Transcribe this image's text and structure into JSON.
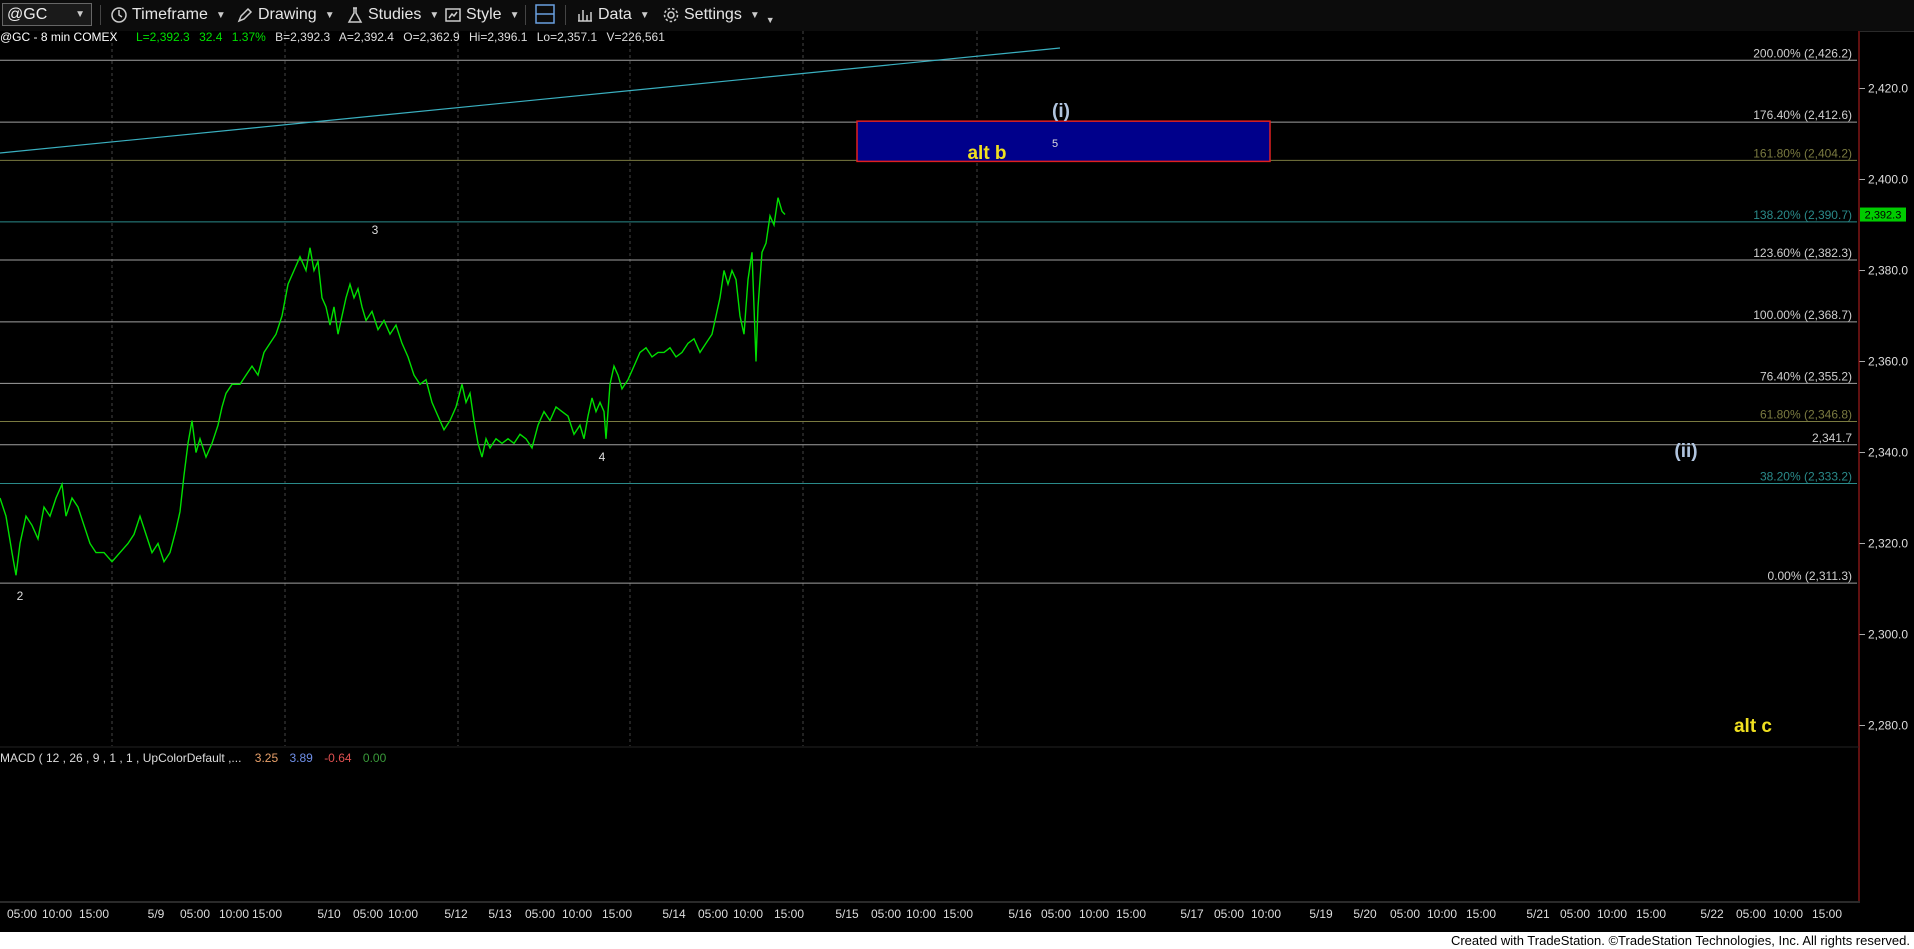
{
  "toolbar": {
    "symbol": "@GC",
    "timeframe": "Timeframe",
    "drawing": "Drawing",
    "studies": "Studies",
    "style": "Style",
    "data": "Data",
    "settings": "Settings"
  },
  "header": {
    "symbol_info": "@GC - 8 min  COMEX",
    "last": "L=2,392.3",
    "change": "32.4",
    "pct": "1.37%",
    "bid": "B=2,392.3",
    "ask": "A=2,392.4",
    "open": "O=2,362.9",
    "high": "Hi=2,396.1",
    "low": "Lo=2,357.1",
    "volume": "V=226,561"
  },
  "macd": {
    "label": "MACD ( 12 , 26 , 9 , 1 , 1 , UpColorDefault ,...",
    "v1": "3.25",
    "v1_color": "#e8a06a",
    "v2": "3.89",
    "v2_color": "#6f8fe8",
    "v3": "-0.64",
    "v3_color": "#e05050",
    "v4": "0.00",
    "v4_color": "#3a9a3a"
  },
  "footer": "Created with TradeStation. ©TradeStation Technologies, Inc. All rights reserved.",
  "annotations": {
    "wave_i": "(i)",
    "wave_ii": "(ii)",
    "alt_b": "alt b",
    "alt_c": "alt c",
    "w2": "2",
    "w3": "3",
    "w4": "4",
    "w5": "5"
  },
  "colors": {
    "price": "#00e000",
    "last_badge": "#00cc00",
    "target_box": "#00008b",
    "target_border": "#e02020"
  },
  "chart_data": {
    "type": "line",
    "title": "@GC - 8 min COMEX",
    "ylim": [
      2273,
      2431
    ],
    "y_ticks": [
      "2,420.0",
      "2,400.0",
      "2,380.0",
      "2,360.0",
      "2,340.0",
      "2,320.0",
      "2,300.0",
      "2,280.0"
    ],
    "y_tick_values": [
      2420,
      2400,
      2380,
      2360,
      2340,
      2320,
      2300,
      2280
    ],
    "x_tick_labels": [
      "05:00",
      "10:00",
      "15:00",
      "5/9",
      "05:00",
      "10:00",
      "15:00",
      "5/10",
      "05:00",
      "10:00",
      "5/12",
      "5/13",
      "05:00",
      "10:00",
      "15:00",
      "5/14",
      "05:00",
      "10:00",
      "15:00",
      "5/15",
      "05:00",
      "10:00",
      "15:00",
      "5/16",
      "05:00",
      "10:00",
      "15:00",
      "5/17",
      "05:00",
      "10:00",
      "5/19",
      "5/20",
      "05:00",
      "10:00",
      "15:00",
      "5/21",
      "05:00",
      "10:00",
      "15:00",
      "5/22",
      "05:00",
      "10:00",
      "15:00"
    ],
    "last_price": "2,392.3",
    "last_price_value": 2392.3,
    "fib_levels": [
      {
        "label": "200.00% (2,426.2)",
        "value": 2426.2,
        "color": "#a0a0a0"
      },
      {
        "label": "176.40% (2,412.6)",
        "value": 2412.6,
        "color": "#a0a0a0"
      },
      {
        "label": "161.80% (2,404.2)",
        "value": 2404.2,
        "color": "#7a7a40"
      },
      {
        "label": "138.20% (2,390.7)",
        "value": 2390.7,
        "color": "#2a8a8a"
      },
      {
        "label": "123.60% (2,382.3)",
        "value": 2382.3,
        "color": "#a0a0a0"
      },
      {
        "label": "100.00% (2,368.7)",
        "value": 2368.7,
        "color": "#a0a0a0"
      },
      {
        "label": "76.40% (2,355.2)",
        "value": 2355.2,
        "color": "#a0a0a0"
      },
      {
        "label": "61.80% (2,346.8)",
        "value": 2346.8,
        "color": "#7a7a40"
      },
      {
        "label": "2,341.7",
        "value": 2341.7,
        "color": "#a0a0a0"
      },
      {
        "label": "38.20% (2,333.2)",
        "value": 2333.2,
        "color": "#2a8a8a"
      },
      {
        "label": "0.00% (2,311.3)",
        "value": 2311.3,
        "color": "#a0a0a0"
      }
    ],
    "target_box": {
      "y_low": 2404.2,
      "y_high": 2412.6
    },
    "series": [
      {
        "name": "",
        "values": [
          [
            0,
            2330
          ],
          [
            6,
            2326
          ],
          [
            12,
            2318
          ],
          [
            16,
            2313
          ],
          [
            20,
            2320
          ],
          [
            26,
            2326
          ],
          [
            32,
            2324
          ],
          [
            38,
            2321
          ],
          [
            44,
            2328
          ],
          [
            50,
            2326
          ],
          [
            56,
            2330
          ],
          [
            62,
            2333
          ],
          [
            66,
            2326
          ],
          [
            72,
            2330
          ],
          [
            78,
            2328
          ],
          [
            84,
            2324
          ],
          [
            90,
            2320
          ],
          [
            96,
            2318
          ],
          [
            104,
            2318
          ],
          [
            112,
            2316
          ],
          [
            120,
            2318
          ],
          [
            128,
            2320
          ],
          [
            134,
            2322
          ],
          [
            140,
            2326
          ],
          [
            146,
            2322
          ],
          [
            152,
            2318
          ],
          [
            158,
            2320
          ],
          [
            164,
            2316
          ],
          [
            170,
            2318
          ],
          [
            176,
            2323
          ],
          [
            180,
            2327
          ],
          [
            184,
            2335
          ],
          [
            188,
            2342
          ],
          [
            192,
            2347
          ],
          [
            196,
            2340
          ],
          [
            200,
            2343
          ],
          [
            206,
            2339
          ],
          [
            212,
            2342
          ],
          [
            218,
            2346
          ],
          [
            222,
            2350
          ],
          [
            226,
            2353
          ],
          [
            232,
            2355
          ],
          [
            240,
            2355
          ],
          [
            246,
            2357
          ],
          [
            252,
            2359
          ],
          [
            258,
            2357
          ],
          [
            264,
            2362
          ],
          [
            270,
            2364
          ],
          [
            276,
            2366
          ],
          [
            282,
            2370
          ],
          [
            288,
            2377
          ],
          [
            294,
            2380
          ],
          [
            300,
            2383
          ],
          [
            306,
            2380
          ],
          [
            310,
            2385
          ],
          [
            314,
            2380
          ],
          [
            318,
            2382
          ],
          [
            322,
            2374
          ],
          [
            326,
            2372
          ],
          [
            330,
            2368
          ],
          [
            334,
            2372
          ],
          [
            338,
            2366
          ],
          [
            342,
            2370
          ],
          [
            346,
            2374
          ],
          [
            350,
            2377
          ],
          [
            354,
            2374
          ],
          [
            358,
            2376
          ],
          [
            362,
            2372
          ],
          [
            366,
            2369
          ],
          [
            372,
            2371
          ],
          [
            378,
            2367
          ],
          [
            384,
            2369
          ],
          [
            390,
            2366
          ],
          [
            396,
            2368
          ],
          [
            402,
            2364
          ],
          [
            408,
            2361
          ],
          [
            414,
            2357
          ],
          [
            420,
            2355
          ],
          [
            426,
            2356
          ],
          [
            432,
            2351
          ],
          [
            438,
            2348
          ],
          [
            444,
            2345
          ],
          [
            450,
            2347
          ],
          [
            456,
            2350
          ],
          [
            462,
            2355
          ],
          [
            466,
            2351
          ],
          [
            470,
            2353
          ],
          [
            474,
            2347
          ],
          [
            478,
            2342
          ],
          [
            482,
            2339
          ],
          [
            486,
            2343
          ],
          [
            490,
            2341
          ],
          [
            496,
            2343
          ],
          [
            502,
            2342
          ],
          [
            508,
            2343
          ],
          [
            514,
            2342
          ],
          [
            520,
            2344
          ],
          [
            526,
            2343
          ],
          [
            532,
            2341
          ],
          [
            538,
            2346
          ],
          [
            544,
            2349
          ],
          [
            550,
            2347
          ],
          [
            556,
            2350
          ],
          [
            562,
            2349
          ],
          [
            568,
            2348
          ],
          [
            574,
            2344
          ],
          [
            580,
            2346
          ],
          [
            584,
            2343
          ],
          [
            588,
            2348
          ],
          [
            592,
            2352
          ],
          [
            596,
            2349
          ],
          [
            600,
            2351
          ],
          [
            604,
            2349
          ],
          [
            606,
            2343
          ],
          [
            610,
            2355
          ],
          [
            614,
            2359
          ],
          [
            618,
            2357
          ],
          [
            622,
            2354
          ],
          [
            628,
            2356
          ],
          [
            634,
            2359
          ],
          [
            640,
            2362
          ],
          [
            646,
            2363
          ],
          [
            652,
            2361
          ],
          [
            658,
            2362
          ],
          [
            664,
            2362
          ],
          [
            670,
            2363
          ],
          [
            676,
            2361
          ],
          [
            682,
            2362
          ],
          [
            688,
            2364
          ],
          [
            694,
            2365
          ],
          [
            700,
            2362
          ],
          [
            706,
            2364
          ],
          [
            712,
            2366
          ],
          [
            716,
            2370
          ],
          [
            720,
            2374
          ],
          [
            724,
            2380
          ],
          [
            728,
            2377
          ],
          [
            732,
            2380
          ],
          [
            736,
            2378
          ],
          [
            740,
            2370
          ],
          [
            744,
            2366
          ],
          [
            748,
            2378
          ],
          [
            752,
            2384
          ],
          [
            756,
            2360
          ],
          [
            758,
            2372
          ],
          [
            762,
            2384
          ],
          [
            766,
            2386
          ],
          [
            770,
            2392
          ],
          [
            774,
            2390
          ],
          [
            778,
            2396
          ],
          [
            782,
            2393
          ],
          [
            785,
            2392.3
          ]
        ]
      }
    ]
  }
}
